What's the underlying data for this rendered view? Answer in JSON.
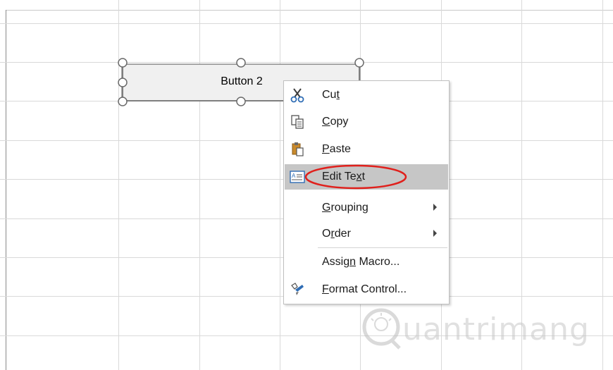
{
  "form_button": {
    "label": "Button 2"
  },
  "context_menu": {
    "items": [
      {
        "pre": "Cu",
        "accel": "t",
        "post": "",
        "icon": "scissors-icon",
        "has_submenu": false
      },
      {
        "pre": "",
        "accel": "C",
        "post": "opy",
        "icon": "copy-icon",
        "has_submenu": false
      },
      {
        "pre": "",
        "accel": "P",
        "post": "aste",
        "icon": "paste-icon",
        "has_submenu": false
      },
      {
        "pre": "Edit Te",
        "accel": "x",
        "post": "t",
        "icon": "edit-text-icon",
        "has_submenu": false,
        "highlighted": true
      },
      {
        "pre": "",
        "accel": "G",
        "post": "rouping",
        "icon": "",
        "has_submenu": true
      },
      {
        "pre": "O",
        "accel": "r",
        "post": "der",
        "icon": "",
        "has_submenu": true
      },
      {
        "pre": "Assig",
        "accel": "n",
        "post": " Macro...",
        "icon": "",
        "has_submenu": false
      },
      {
        "pre": "",
        "accel": "F",
        "post": "ormat Control...",
        "icon": "format-control-icon",
        "has_submenu": false
      }
    ]
  },
  "annotation": {
    "color": "#e0201c"
  },
  "watermark": {
    "text": "uantrimang",
    "logo": "lightbulb-q-icon"
  }
}
